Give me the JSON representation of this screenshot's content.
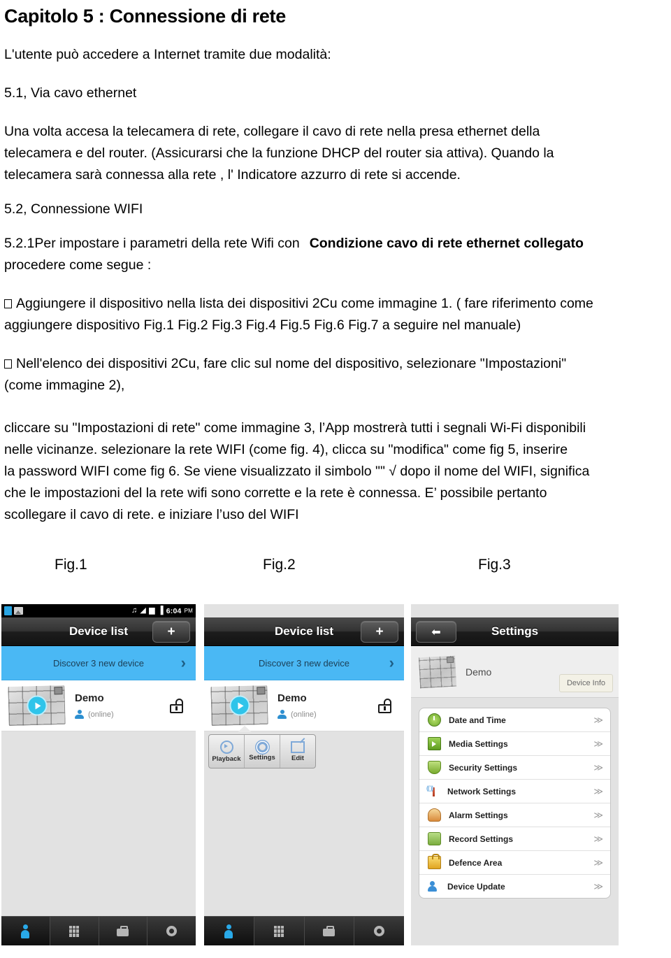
{
  "document": {
    "chapter_title": "Capitolo 5 : Connessione di rete",
    "intro": "L'utente può accedere a Internet tramite due modalità:",
    "section_5_1_title": "5.1, Via cavo ethernet",
    "section_5_1_body_line1": "Una volta accesa la    telecamera di rete, collegare il cavo di rete nella presa ethernet    della",
    "section_5_1_body_line2": "telecamera    e del router. (Assicurarsi che la funzione    DHCP del router sia attiva). Quando la",
    "section_5_1_body_line3": "telecamera sarà connessa alla rete , l' Indicatore azzurro di rete si accende.",
    "section_5_2_title": "5.2, Connessione WIFI",
    "section_5_2_1_lead": "5.2.1Per impostare i parametri della rete Wifi con",
    "section_5_2_1_bold": "Condizione cavo di rete ethernet collegato",
    "section_5_2_1_cont": "procedere come segue :",
    "bullet_1_line1": "Aggiungere il dispositivo nella lista dei dispositivi 2Cu come immagine 1. ( fare riferimento come",
    "bullet_1_line2": "aggiungere dispositivo Fig.1 Fig.2 Fig.3 Fig.4 Fig.5 Fig.6 Fig.7 a seguire nel manuale)",
    "bullet_2_line1": "Nell'elenco dei dispositivi 2Cu, fare clic sul nome del dispositivo, selezionare \"Impostazioni\"",
    "bullet_2_line2": "(come immagine 2),",
    "para_3_line1": "cliccare su \"Impostazioni di rete\" come immagine 3, l’App mostrerà tutti i segnali Wi-Fi disponibili",
    "para_3_line2": "nelle vicinanze. selezionare la rete    WIFI (come fig. 4),    clicca su \"modifica\" come fig    5, inserire",
    "para_3_line3": "la password WIFI come fig 6. Se viene visualizzato il simbolo    \"\" √ dopo il nome del WIFI, significa",
    "para_3_line4": "che le impostazioni del la rete wifi sono corrette e la rete è connessa. E’    possibile pertanto",
    "para_3_line5": "scollegare il cavo di rete. e iniziare l’uso del WIFI"
  },
  "figures": {
    "caption_1": "Fig.1",
    "caption_2": "Fig.2",
    "caption_3": "Fig.3"
  },
  "fig1": {
    "statusbar": {
      "time": "6:04",
      "meridiem": "PM",
      "headphone_glyph": "♫",
      "wifi_glyph": "◢",
      "signal_glyph": "▆",
      "battery_glyph": "▐"
    },
    "titlebar": {
      "title": "Device list",
      "add_label": "+"
    },
    "discover": {
      "text": "Discover  3   new device",
      "chevron": "›"
    },
    "device": {
      "name": "Demo",
      "status": "(online)"
    },
    "tabbar": {
      "tab1": "user-tab",
      "tab2": "apps-tab",
      "tab3": "toolbox-tab",
      "tab4": "settings-tab"
    }
  },
  "fig2": {
    "titlebar": {
      "title": "Device list",
      "add_label": "+"
    },
    "discover": {
      "text": "Discover  3   new device",
      "chevron": "›"
    },
    "device": {
      "name": "Demo",
      "status": "(online)"
    },
    "popup": {
      "playback": "Playback",
      "settings": "Settings",
      "edit": "Edit"
    }
  },
  "fig3": {
    "titlebar": {
      "title": "Settings",
      "back_glyph": "⬅"
    },
    "device": {
      "name": "Demo",
      "info_button": "Device Info"
    },
    "settings_rows": [
      {
        "label": "Date and Time",
        "icon": "clock-icon",
        "arrow": "≫"
      },
      {
        "label": "Media Settings",
        "icon": "media-icon",
        "arrow": "≫"
      },
      {
        "label": "Security Settings",
        "icon": "shield-icon",
        "arrow": "≫"
      },
      {
        "label": "Network Settings",
        "icon": "network-icon",
        "arrow": "≫"
      },
      {
        "label": "Alarm Settings",
        "icon": "bell-icon",
        "arrow": "≫"
      },
      {
        "label": "Record Settings",
        "icon": "record-icon",
        "arrow": "≫"
      },
      {
        "label": "Defence Area",
        "icon": "padlock-icon",
        "arrow": "≫"
      },
      {
        "label": "Device Update",
        "icon": "update-icon",
        "arrow": "≫"
      }
    ]
  },
  "colors": {
    "accent_blue": "#4ab8f4",
    "titlebar_dark": "#1d1d1d",
    "page_bg": "#ffffff",
    "phone_bg": "#e2e2e2"
  }
}
